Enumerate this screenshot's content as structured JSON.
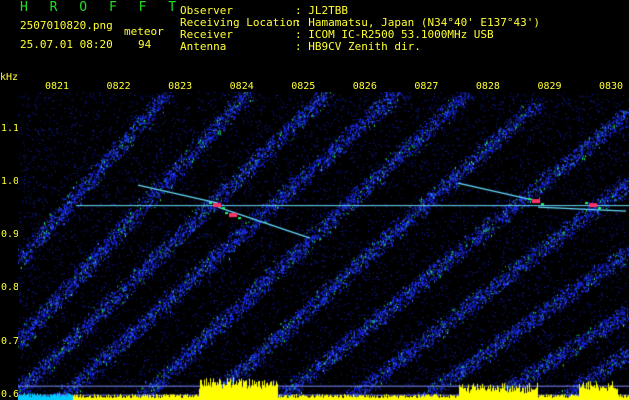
{
  "header": {
    "title": "H R O F F T",
    "filename": "2507010820.png",
    "type": "meteor",
    "datetime": "25.07.01 08:20",
    "count": "94",
    "observer_label": "Observer",
    "observer_value": ": JL2TBB",
    "location_label": "Receiving Location",
    "location_value": ": Hamamatsu, Japan (N34°40' E137°43')",
    "receiver_label": "Receiver",
    "receiver_value": ": ICOM IC-R2500 53.1000MHz USB",
    "antenna_label": "Antenna",
    "antenna_value": ": HB9CV Zenith dir."
  },
  "chart_data": {
    "type": "heatmap",
    "ylabel": "kHz",
    "x_ticks": [
      "0821",
      "0822",
      "0823",
      "0824",
      "0825",
      "0826",
      "0827",
      "0828",
      "0829",
      "0830"
    ],
    "y_ticks": [
      "1.1",
      "1.0",
      "0.9",
      "0.8",
      "0.7",
      "0.6"
    ],
    "ylim": [
      0.59,
      1.17
    ],
    "carrier_khz": 0.957,
    "colors": {
      "background": "#000000",
      "noise": "#1a2aff",
      "signal": "#22ff66",
      "peak": "#ff3366",
      "carrier": "#66ddff",
      "bars": "#ffff00",
      "bars_low": "#00ccff",
      "text": "#ffff33"
    }
  }
}
